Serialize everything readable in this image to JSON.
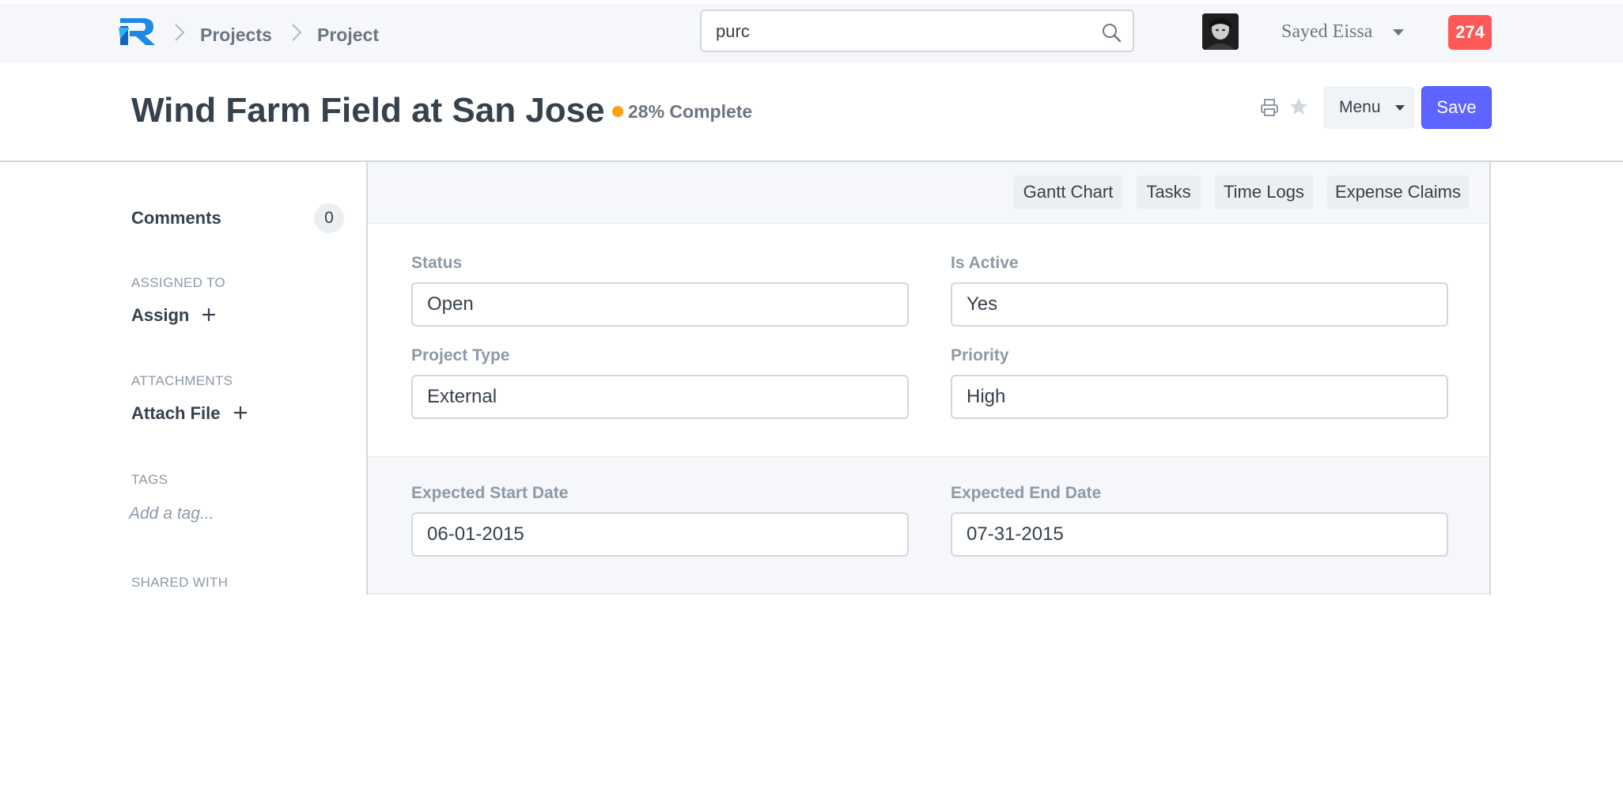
{
  "navbar": {
    "breadcrumbs": [
      "Projects",
      "Project"
    ],
    "search": {
      "value": "purc"
    },
    "user": {
      "name": "Sayed Eissa"
    },
    "notifications": {
      "count": "274"
    }
  },
  "page": {
    "title": "Wind Farm Field at San Jose",
    "status": {
      "text": "28% Complete",
      "color": "#ffa00a"
    },
    "menu_label": "Menu",
    "save_label": "Save"
  },
  "sidebar": {
    "comments": {
      "label": "Comments",
      "count": "0"
    },
    "assigned_to": {
      "label": "ASSIGNED TO",
      "action": "Assign"
    },
    "attachments": {
      "label": "ATTACHMENTS",
      "action": "Attach File"
    },
    "tags": {
      "label": "TAGS",
      "placeholder": "Add a tag..."
    },
    "shared_with": {
      "label": "SHARED WITH"
    }
  },
  "form": {
    "toolbar": [
      "Gantt Chart",
      "Tasks",
      "Time Logs",
      "Expense Claims"
    ],
    "fields": {
      "status": {
        "label": "Status",
        "value": "Open"
      },
      "is_active": {
        "label": "Is Active",
        "value": "Yes"
      },
      "project_type": {
        "label": "Project Type",
        "value": "External"
      },
      "priority": {
        "label": "Priority",
        "value": "High"
      },
      "expected_start_date": {
        "label": "Expected Start Date",
        "value": "06-01-2015"
      },
      "expected_end_date": {
        "label": "Expected End Date",
        "value": "07-31-2015"
      }
    }
  },
  "colors": {
    "primary": "#5e64ff",
    "danger": "#ff5858",
    "warning": "#ffa00a"
  }
}
